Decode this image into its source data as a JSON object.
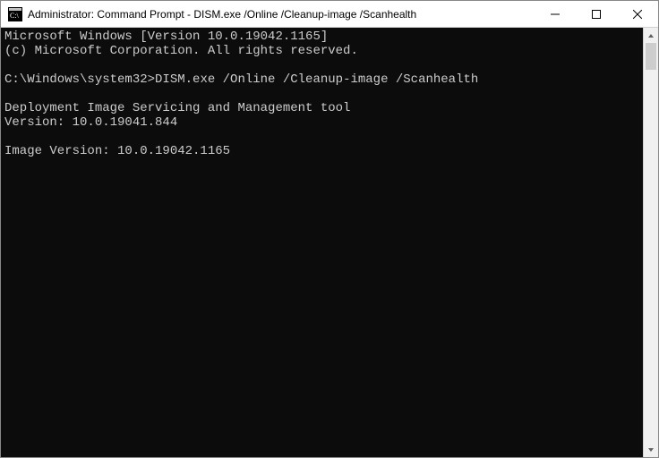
{
  "titlebar": {
    "title": "Administrator: Command Prompt - DISM.exe  /Online /Cleanup-image /Scanhealth"
  },
  "console": {
    "line1": "Microsoft Windows [Version 10.0.19042.1165]",
    "line2": "(c) Microsoft Corporation. All rights reserved.",
    "blank1": "",
    "prompt": "C:\\Windows\\system32>",
    "command": "DISM.exe /Online /Cleanup-image /Scanhealth",
    "blank2": "",
    "tool_line": "Deployment Image Servicing and Management tool",
    "version_line": "Version: 10.0.19041.844",
    "blank3": "",
    "image_version_line": "Image Version: 10.0.19042.1165"
  }
}
